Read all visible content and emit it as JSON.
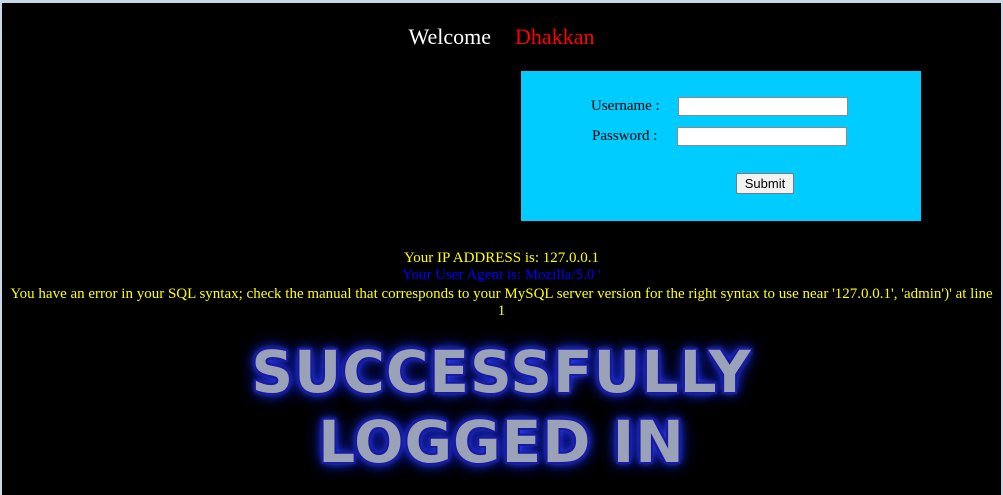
{
  "welcome": {
    "greeting": "Welcome",
    "name": "Dhakkan"
  },
  "login": {
    "username_label": "Username :",
    "password_label": "Password :",
    "username_value": "",
    "password_value": "",
    "submit_label": "Submit",
    "box_color": "#00ccff"
  },
  "info": {
    "ip_line": "Your IP ADDRESS is: 127.0.0.1",
    "user_agent_line": "Your User Agent is: Mozilla/5.0 '",
    "error_line": "You have an error in your SQL syntax; check the manual that corresponds to your MySQL server version for the right syntax to use near '127.0.0.1', 'admin')' at line 1"
  },
  "banner": {
    "line1": "SUCCESSFULLY",
    "line2": "LOGGED IN"
  },
  "colors": {
    "background": "#000000",
    "name": "#ff0000",
    "info": "#ffff00",
    "user_agent": "#0000ff"
  }
}
